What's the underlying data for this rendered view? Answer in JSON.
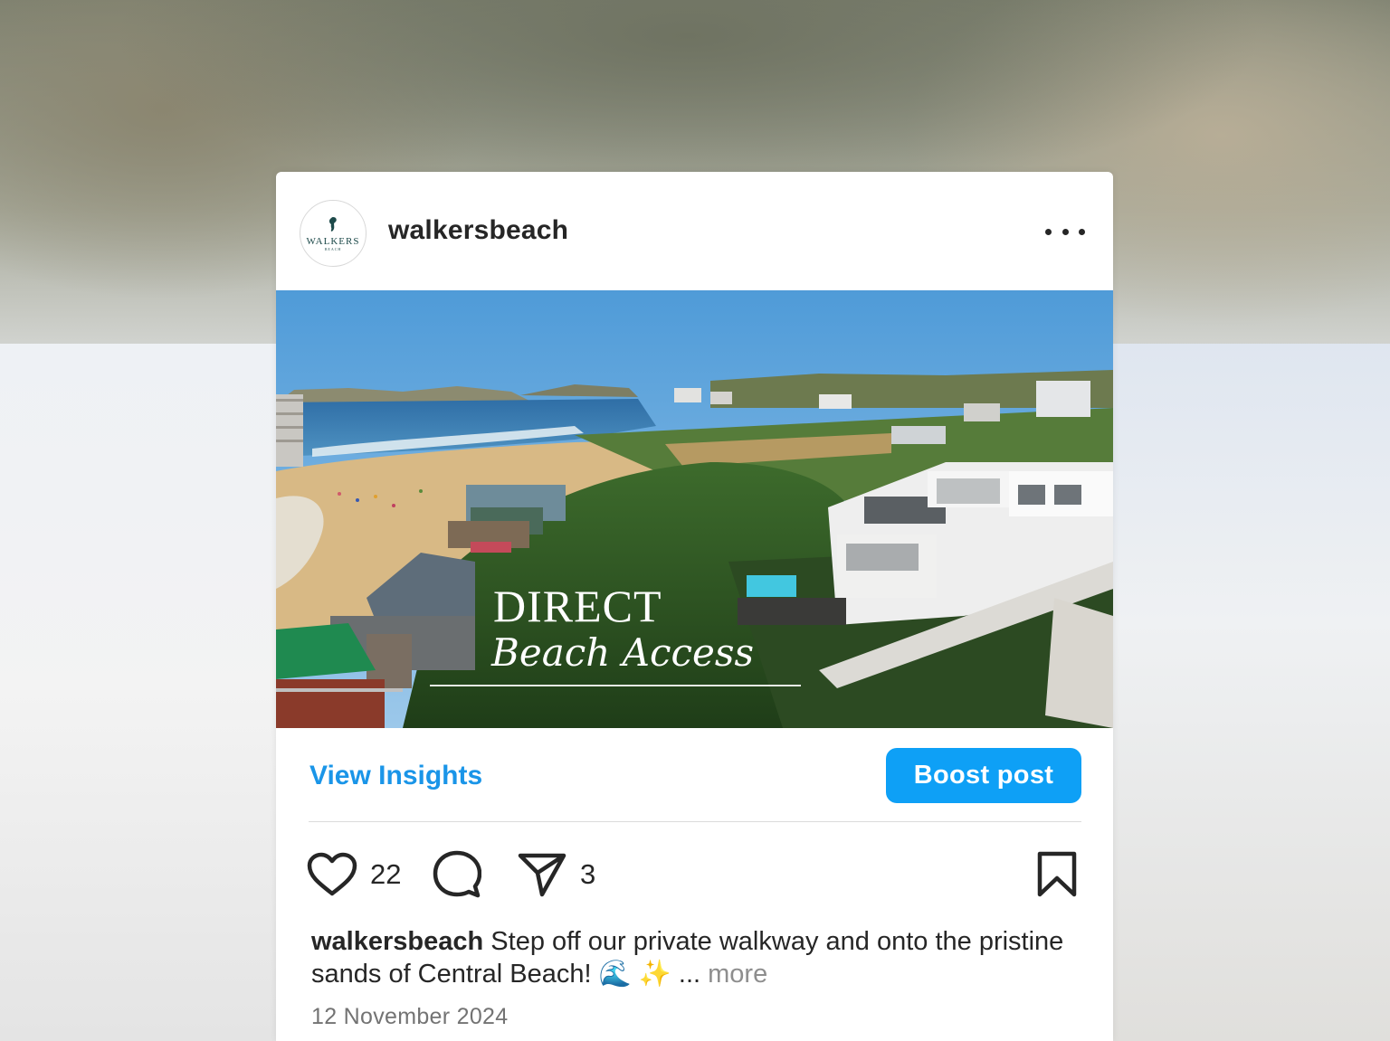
{
  "post": {
    "username": "walkersbeach",
    "avatar_brand": {
      "name": "WALKERS",
      "sub": "BEACH"
    },
    "media": {
      "overlay_title": "DIRECT",
      "overlay_subtitle": "Beach Access"
    },
    "view_insights_label": "View Insights",
    "boost_label": "Boost post",
    "likes": "22",
    "shares": "3",
    "caption": {
      "user": "walkersbeach",
      "text": "Step off our private walkway and onto the pristine sands of Central Beach! 🌊 ✨ ...",
      "more": "more"
    },
    "date": "12 November 2024"
  },
  "icons": {
    "more": "more-horizontal-icon",
    "like": "heart-icon",
    "comment": "comment-icon",
    "share": "send-icon",
    "save": "bookmark-icon"
  },
  "colors": {
    "accent": "#0ea0f6",
    "link": "#1a95e8",
    "text": "#262626",
    "muted": "#8e8e8e"
  }
}
